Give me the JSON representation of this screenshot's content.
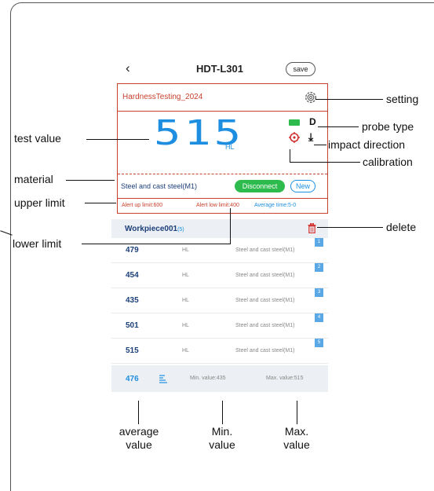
{
  "app": {
    "back_glyph": "‹",
    "title": "HDT-L301",
    "save_label": "save"
  },
  "measurement": {
    "file_name": "HardnessTesting_2024",
    "value": "515",
    "unit": "HL",
    "probe_type": "D",
    "impact_direction_glyph": "⤓",
    "material": "Steel and cast steel(M1)",
    "disconnect_label": "Disconnect",
    "new_label": "New",
    "alert_up": "Alert up limit:600",
    "alert_low": "Alert low limit:400",
    "average_time": "Average time:5-0"
  },
  "workpiece": {
    "name": "Workpiece001",
    "count": "(5)",
    "rows": [
      {
        "value": "479",
        "unit": "HL",
        "material": "Steel and cast steel(M1)",
        "index": "1"
      },
      {
        "value": "454",
        "unit": "HL",
        "material": "Steel and cast steel(M1)",
        "index": "2"
      },
      {
        "value": "435",
        "unit": "HL",
        "material": "Steel and cast steel(M1)",
        "index": "3"
      },
      {
        "value": "501",
        "unit": "HL",
        "material": "Steel and cast steel(M1)",
        "index": "4"
      },
      {
        "value": "515",
        "unit": "HL",
        "material": "Steel and cast steel(M1)",
        "index": "5"
      }
    ]
  },
  "summary": {
    "average": "476",
    "min": "Min. value:435",
    "max": "Max. value:515"
  },
  "annotations": {
    "test_value": "test value",
    "material": "material",
    "upper_limit": "upper limit",
    "lower_limit": "lower limit",
    "setting": "setting",
    "probe_type": "probe type",
    "impact_direction": "impact direction",
    "calibration": "calibration",
    "delete": "delete",
    "average_value_1": "average",
    "average_value_2": "value",
    "min_value_1": "Min.",
    "min_value_2": "value",
    "max_value_1": "Max.",
    "max_value_2": "value"
  },
  "colors": {
    "accent_red": "#c9412d",
    "accent_blue": "#1e8fe0",
    "accent_green": "#2dbb4d",
    "text_navy": "#1c3f7a"
  },
  "icons": [
    "gear-icon",
    "battery-icon",
    "calibration-target-icon",
    "impact-direction-icon",
    "trash-icon",
    "statistics-icon",
    "back-chevron-icon"
  ]
}
